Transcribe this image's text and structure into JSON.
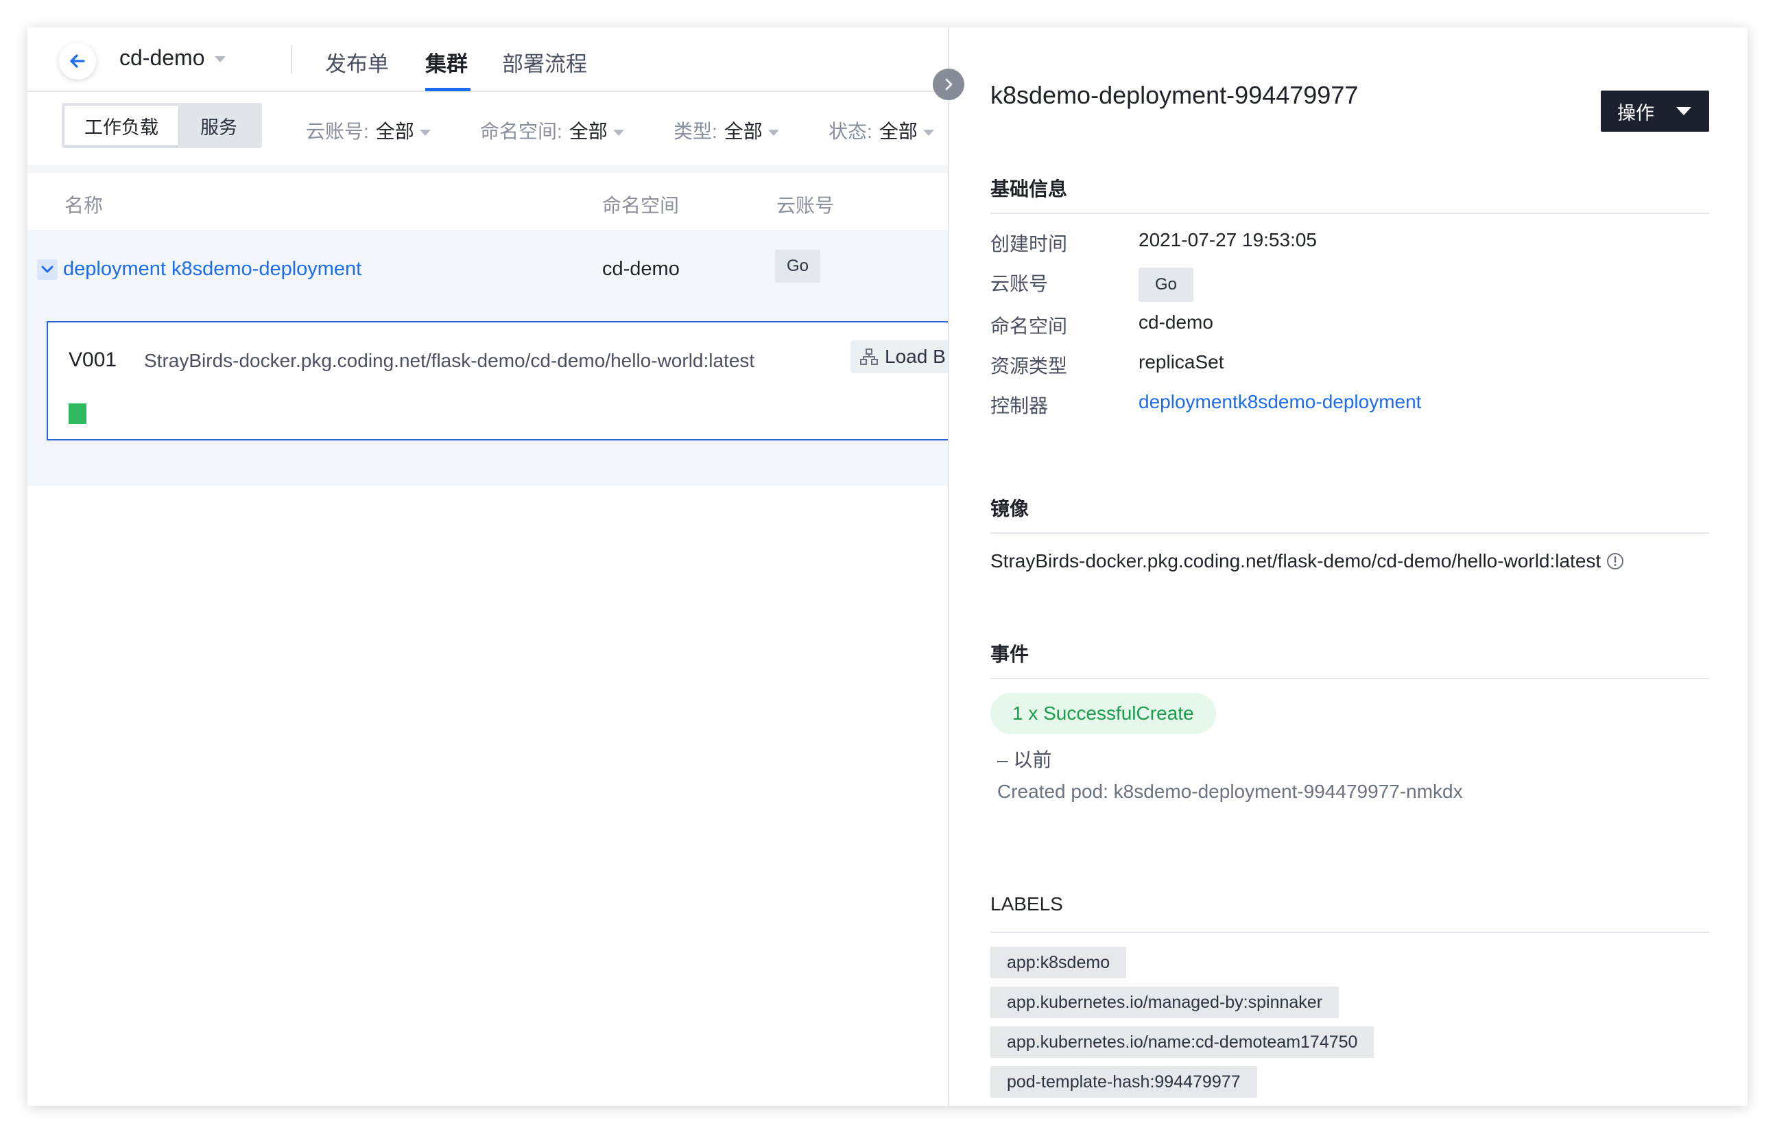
{
  "header": {
    "project_name": "cd-demo",
    "tabs": [
      {
        "label": "发布单"
      },
      {
        "label": "集群"
      },
      {
        "label": "部署流程"
      }
    ]
  },
  "filters": {
    "segment": {
      "workload": "工作负载",
      "service": "服务"
    },
    "cloud_account": {
      "label": "云账号:",
      "value": "全部"
    },
    "namespace": {
      "label": "命名空间:",
      "value": "全部"
    },
    "type": {
      "label": "类型:",
      "value": "全部"
    },
    "status": {
      "label": "状态:",
      "value": "全部"
    }
  },
  "table": {
    "columns": [
      "名称",
      "命名空间",
      "云账号"
    ],
    "rows": [
      {
        "name": "deployment k8sdemo-deployment",
        "namespace": "cd-demo",
        "account": "Go"
      }
    ]
  },
  "server_group": {
    "version": "V001",
    "image": "StrayBirds-docker.pkg.coding.net/flask-demo/cd-demo/hello-world:latest",
    "load_balancer_label": "Load B",
    "pod_color": "#2dba5e"
  },
  "detail": {
    "title": "k8sdemo-deployment-994479977",
    "action_button": "操作",
    "basic": {
      "heading": "基础信息",
      "created_label": "创建时间",
      "created_value": "2021-07-27 19:53:05",
      "account_label": "云账号",
      "account_value": "Go",
      "namespace_label": "命名空间",
      "namespace_value": "cd-demo",
      "resource_type_label": "资源类型",
      "resource_type_value": "replicaSet",
      "controller_label": "控制器",
      "controller_value": "deploymentk8sdemo-deployment"
    },
    "image": {
      "heading": "镜像",
      "value": "StrayBirds-docker.pkg.coding.net/flask-demo/cd-demo/hello-world:latest"
    },
    "events": {
      "heading": "事件",
      "badge": "1 x SuccessfulCreate",
      "time": "– 以前",
      "message": "Created pod: k8sdemo-deployment-994479977-nmkdx"
    },
    "labels": {
      "heading": "LABELS",
      "items": [
        "app:k8sdemo",
        "app.kubernetes.io/managed-by:spinnaker",
        "app.kubernetes.io/name:cd-demoteam174750",
        "pod-template-hash:994479977"
      ]
    }
  },
  "colors": {
    "accent": "#1d6bf3",
    "dark_button": "#1b222e",
    "success": "#1a9d4c"
  }
}
